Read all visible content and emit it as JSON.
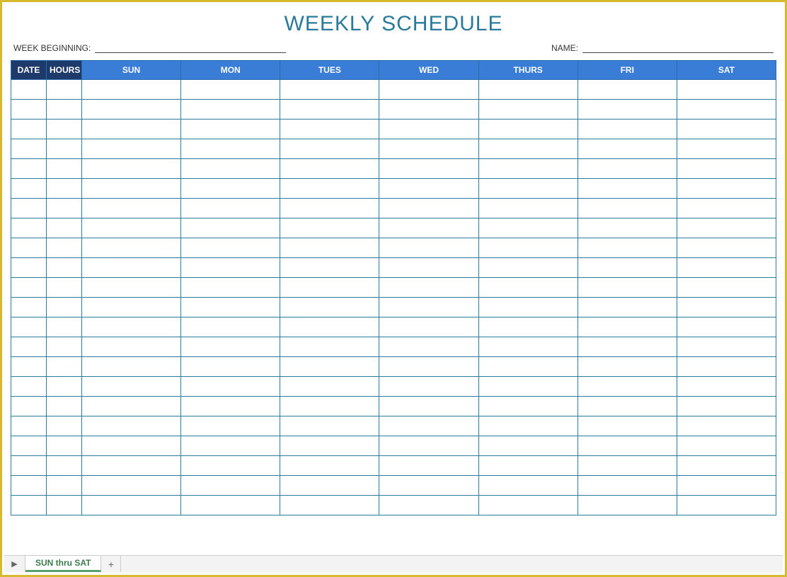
{
  "title": "WEEKLY SCHEDULE",
  "meta": {
    "week_beginning_label": "WEEK BEGINNING:",
    "name_label": "NAME:"
  },
  "headers": {
    "date": "DATE",
    "hours": "HOURS",
    "days": [
      "SUN",
      "MON",
      "TUES",
      "WED",
      "THURS",
      "FRI",
      "SAT"
    ]
  },
  "row_count": 22,
  "footer": {
    "active_tab": "SUN thru SAT"
  }
}
